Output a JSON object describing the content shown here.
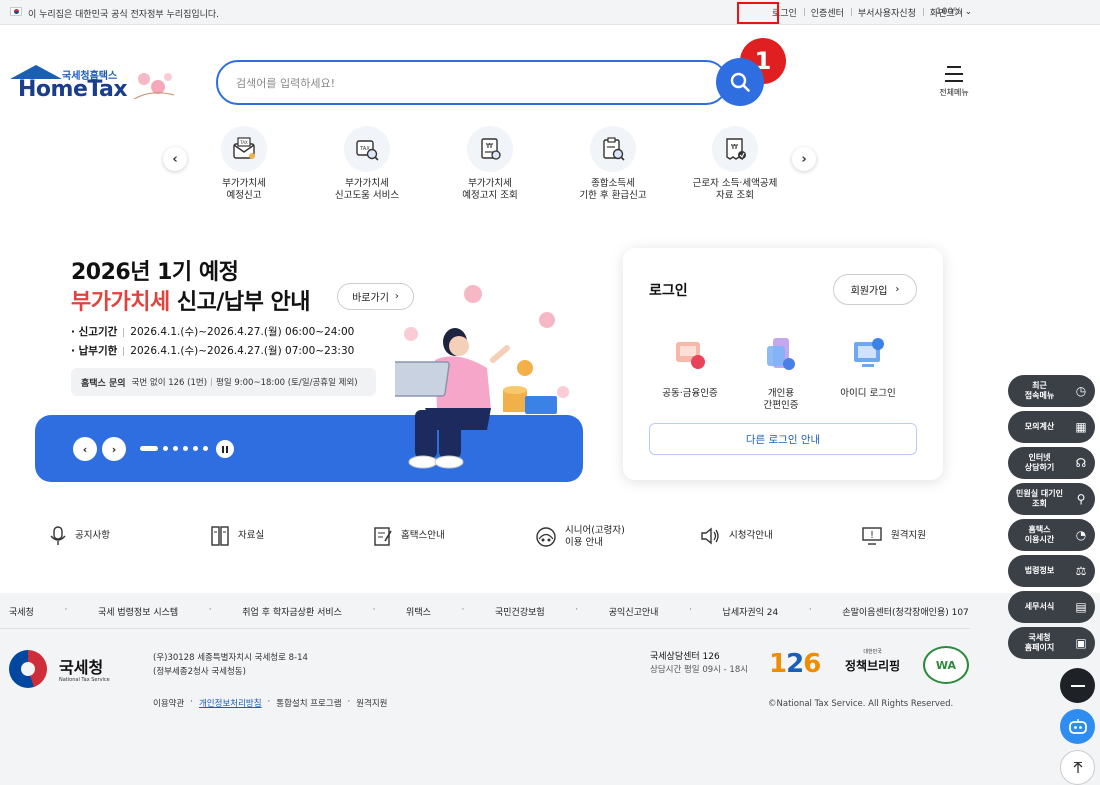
{
  "gov_bar": {
    "notice": "이 누리집은 대한민국 공식 전자정부 누리집입니다.",
    "links": [
      "로그인",
      "인증센터",
      "부서사용자신청",
      "화면크기"
    ],
    "zoom": "100%"
  },
  "step_badge": "1",
  "header": {
    "logo_small": "국세청홈택스",
    "logo_big": "HomeTax",
    "search_placeholder": "검색어를 입력하세요!",
    "all_menu": "전체메뉴"
  },
  "quick_menu": [
    {
      "label": "부가가치세\n예정신고",
      "icon": "tax-envelope-icon"
    },
    {
      "label": "부가가치세\n신고도움 서비스",
      "icon": "tax-search-icon"
    },
    {
      "label": "부가가치세\n예정고지 조회",
      "icon": "won-document-icon"
    },
    {
      "label": "종합소득세\n기한 후 환급신고",
      "icon": "clipboard-search-icon"
    },
    {
      "label": "근로자 소득·세액공제\n자료 조회",
      "icon": "won-receipt-icon"
    }
  ],
  "banner": {
    "title_line1": "2026년 1기 예정",
    "title_line2_red": "부가가치세",
    "title_line2_rest": " 신고/납부 안내",
    "goto_label": "바로가기",
    "periods": [
      {
        "label": "· 신고기간",
        "value": "2026.4.1.(수)~2026.4.27.(월) 06:00~24:00"
      },
      {
        "label": "· 납부기한",
        "value": "2026.4.1.(수)~2026.4.27.(월) 07:00~23:30"
      }
    ],
    "inquiry_label": "홈택스 문의",
    "inquiry_phone": "국번 없이 126 (1번)",
    "inquiry_hours": "평일 9:00~18:00 (토/일/공휴일 제외)"
  },
  "login_box": {
    "title": "로그인",
    "join": "회원가입",
    "options": [
      {
        "label": "공동·금융인증",
        "icon": "certificate-icon"
      },
      {
        "label": "개인용\n간편인증",
        "icon": "simple-auth-icon"
      },
      {
        "label": "아이디 로그인",
        "icon": "id-login-icon"
      }
    ],
    "other_login": "다른 로그인 안내"
  },
  "bottom_links": [
    {
      "label": "공지사항",
      "icon": "microphone-icon"
    },
    {
      "label": "자료실",
      "icon": "archive-icon"
    },
    {
      "label": "홈택스안내",
      "icon": "guide-icon"
    },
    {
      "label": "시니어(고령자)\n이용 안내",
      "icon": "senior-icon"
    },
    {
      "label": "시청각안내",
      "icon": "speaker-icon"
    },
    {
      "label": "원격지원",
      "icon": "remote-support-icon"
    }
  ],
  "footer": {
    "links": [
      "국세청",
      "국세 법령정보 시스템",
      "취업 후 학자금상환 서비스",
      "위택스",
      "국민건강보험",
      "공익신고안내",
      "납세자권익 24",
      "손말이음센터(청각장애인용) 107"
    ],
    "org_name": "국세청",
    "org_en": "National Tax Service",
    "address_line1": "(우)30128 세종특별자치시 국세청로 8-14",
    "address_line2": "(정부세종2청사 국세청동)",
    "nav": [
      "이용약관",
      "개인정보처리방침",
      "통합설치 프로그램",
      "원격지원"
    ],
    "call_center": "국세상담센터 126",
    "call_hours": "상담시간 평일 09시 - 18시",
    "badge_126": "126",
    "policy_small": "대한민국",
    "policy_big": "정책브리핑",
    "wa_mark": "WA",
    "copyright": "©National Tax Service. All Rights Reserved."
  },
  "right_menu": [
    {
      "label": "최근\n접속메뉴",
      "icon": "clock-icon"
    },
    {
      "label": "모의계산",
      "icon": "calculator-icon"
    },
    {
      "label": "인터넷\n상담하기",
      "icon": "headset-icon"
    },
    {
      "label": "민원실 대기인\n조회",
      "icon": "person-search-icon"
    },
    {
      "label": "홈택스\n이용시간",
      "icon": "time-icon"
    },
    {
      "label": "법령정보",
      "icon": "gavel-icon"
    },
    {
      "label": "세무서식",
      "icon": "form-icon"
    },
    {
      "label": "국세청\n홈페이지",
      "icon": "homepage-icon"
    }
  ],
  "colors": {
    "primary": "#2f6ee0",
    "red": "#e0433d",
    "dark": "#3b3f46"
  }
}
